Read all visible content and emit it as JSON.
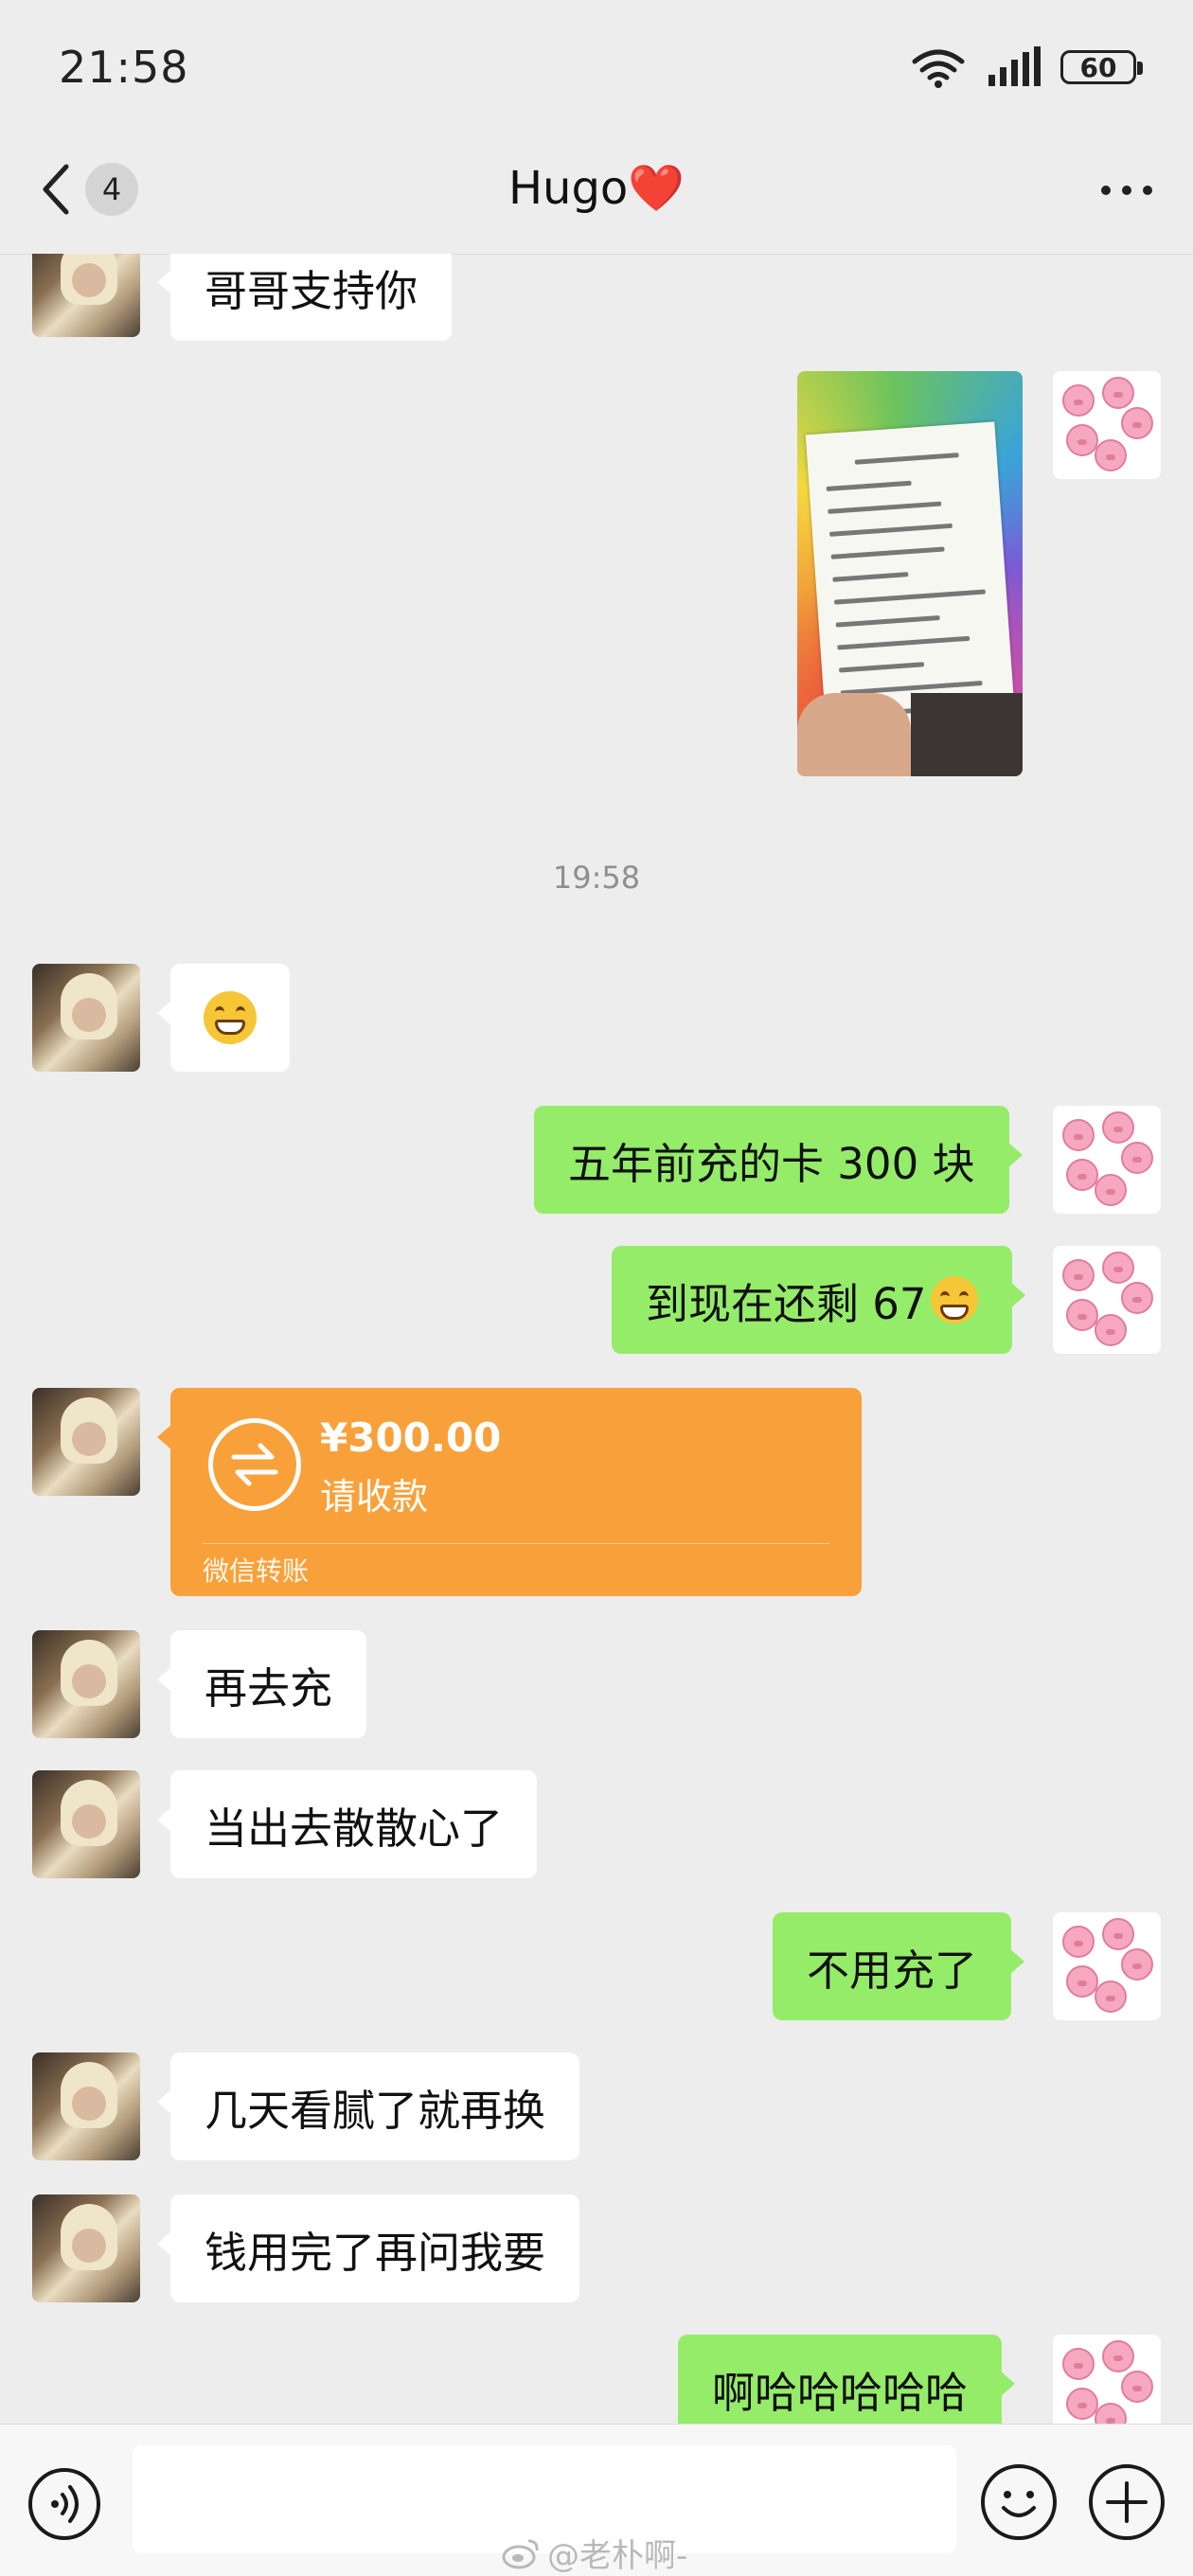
{
  "status_bar": {
    "time": "21:58",
    "battery": "60"
  },
  "header": {
    "back_count": "4",
    "title": "Hugo❤️"
  },
  "messages": {
    "m1": "哥哥支持你",
    "timestamp": "19:58",
    "m3": "五年前充的卡 300 块",
    "m4": "到现在还剩 67",
    "m5": "再去充",
    "m6": "当出去散散心了",
    "m7": "不用充了",
    "m8": "几天看腻了就再换",
    "m9": "钱用完了再问我要",
    "m10": "啊哈哈哈哈哈"
  },
  "transfer": {
    "amount": "¥300.00",
    "status": "请收款",
    "footer": "微信转账"
  },
  "input": {
    "placeholder": ""
  },
  "watermark": {
    "text": "@老朴啊-"
  },
  "icons": {
    "back": "chevron-left-icon",
    "more": "more-dots-icon",
    "voice": "voice-icon",
    "emoji": "emoji-icon",
    "plus": "plus-icon",
    "transfer": "transfer-icon"
  },
  "colors": {
    "sent_bubble": "#95ec69",
    "received_bubble": "#ffffff",
    "transfer": "#f8a13b",
    "background": "#ededed"
  }
}
